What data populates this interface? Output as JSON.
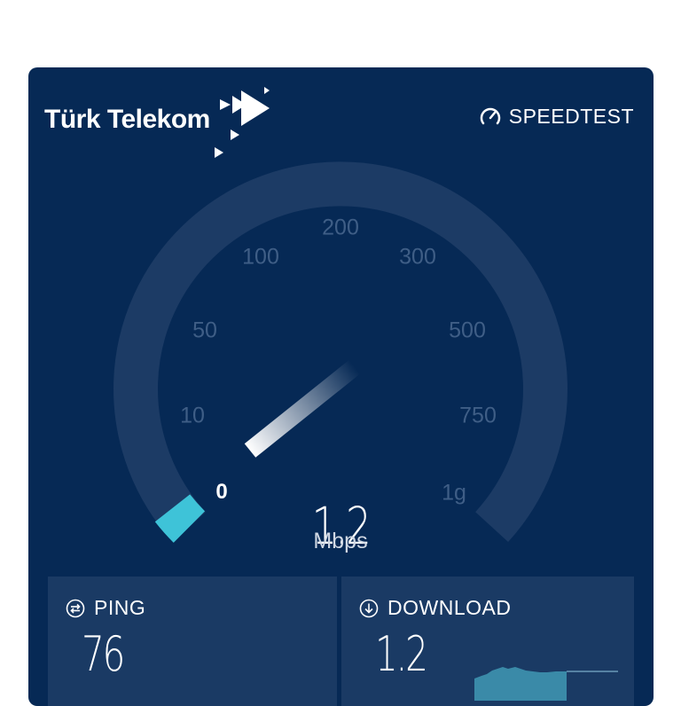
{
  "header": {
    "brand": "Türk Telekom",
    "speedtest_label": "SPEEDTEST",
    "icons": [
      "turk-telekom-logo-icon",
      "speedometer-icon"
    ]
  },
  "gauge": {
    "tick_labels": [
      "0",
      "10",
      "50",
      "100",
      "200",
      "300",
      "500",
      "750",
      "1g"
    ],
    "current_value": "1.2",
    "unit": "Mbps",
    "accent_color": "#3ec3d8",
    "track_color": "#1c3b65"
  },
  "ping": {
    "label": "PING",
    "value": "76",
    "icon": "ping-icon"
  },
  "download": {
    "label": "DOWNLOAD",
    "value": "1.2",
    "icon": "download-arrow-icon"
  }
}
